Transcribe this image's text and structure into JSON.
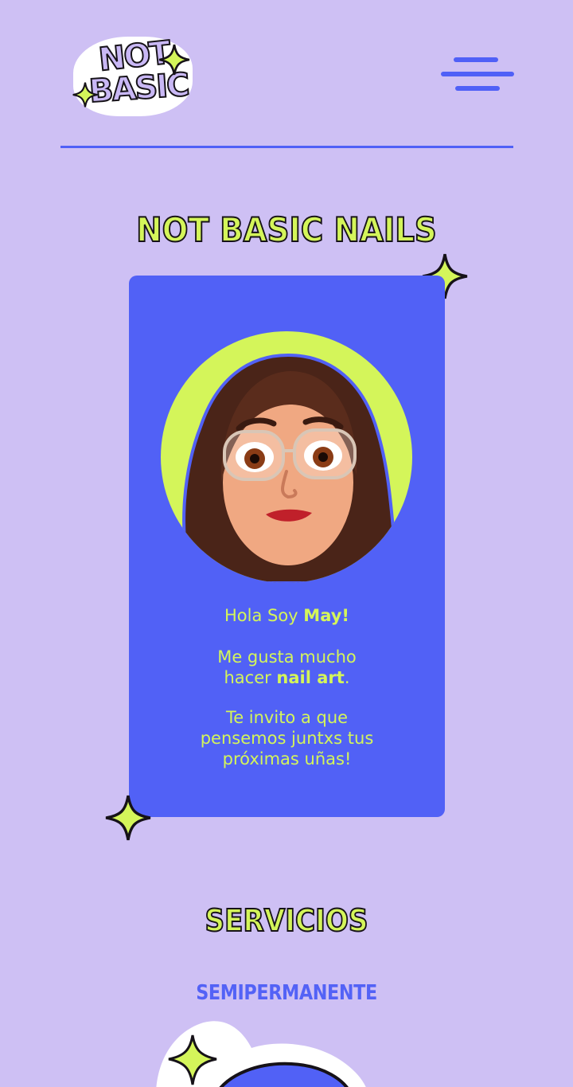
{
  "header": {
    "logo_line1": "NOT",
    "logo_line2": "BASIC",
    "menu_icon": "hamburger-menu-icon"
  },
  "hero": {
    "title": "NOT BASIC NAILS"
  },
  "profile_card": {
    "greeting_prefix": "Hola Soy ",
    "greeting_name": "May!",
    "line2_a": "Me gusta mucho",
    "line2_b_prefix": "hacer ",
    "line2_b_bold": "nail art",
    "line2_b_suffix": ".",
    "line3_a": "Te invito a que",
    "line3_b": "pensemos juntxs tus",
    "line3_c": "próximas uñas!"
  },
  "services": {
    "title": "SERVICIOS",
    "first_service": "SEMIPERMANENTE"
  },
  "colors": {
    "background": "#cec0f4",
    "accent_blue": "#5161f6",
    "accent_lime": "#d4f55a",
    "outline": "#161218"
  }
}
